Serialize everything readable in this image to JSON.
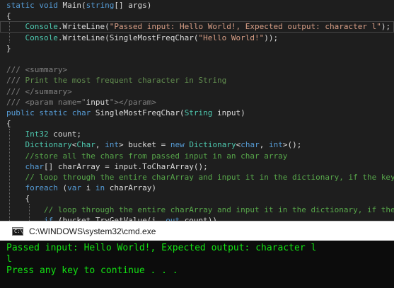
{
  "code_lines": [
    [
      {
        "t": "static ",
        "c": "t-kw"
      },
      {
        "t": "void ",
        "c": "t-kw"
      },
      {
        "t": "Main(",
        "c": "t-pl"
      },
      {
        "t": "string",
        "c": "t-kw"
      },
      {
        "t": "[] args)",
        "c": "t-pl"
      }
    ],
    [
      {
        "t": "{",
        "c": "t-pl"
      }
    ],
    [
      {
        "t": "    ",
        "c": "t-pl"
      },
      {
        "t": "Console",
        "c": "t-ty"
      },
      {
        "t": ".WriteLine(",
        "c": "t-pl"
      },
      {
        "t": "\"Passed input: Hello World!, Expected output: character l\"",
        "c": "t-str"
      },
      {
        "t": ");",
        "c": "t-pl"
      }
    ],
    [
      {
        "t": "    ",
        "c": "t-pl"
      },
      {
        "t": "Console",
        "c": "t-ty"
      },
      {
        "t": ".WriteLine(SingleMostFreqChar(",
        "c": "t-pl"
      },
      {
        "t": "\"Hello World!\"",
        "c": "t-str"
      },
      {
        "t": "));",
        "c": "t-pl"
      }
    ],
    [
      {
        "t": "}",
        "c": "t-pl"
      }
    ],
    [],
    [
      {
        "t": "/// ",
        "c": "t-tag"
      },
      {
        "t": "<summary>",
        "c": "t-tag"
      }
    ],
    [
      {
        "t": "/// ",
        "c": "t-tag"
      },
      {
        "t": "Print the most frequent character in String",
        "c": "t-dc"
      }
    ],
    [
      {
        "t": "/// ",
        "c": "t-tag"
      },
      {
        "t": "</summary>",
        "c": "t-tag"
      }
    ],
    [
      {
        "t": "/// ",
        "c": "t-tag"
      },
      {
        "t": "<param ",
        "c": "t-tag"
      },
      {
        "t": "name",
        "c": "t-tag"
      },
      {
        "t": "=\"",
        "c": "t-tag"
      },
      {
        "t": "input",
        "c": "t-pl"
      },
      {
        "t": "\">",
        "c": "t-tag"
      },
      {
        "t": "</param>",
        "c": "t-tag"
      }
    ],
    [
      {
        "t": "public ",
        "c": "t-kw"
      },
      {
        "t": "static ",
        "c": "t-kw"
      },
      {
        "t": "char ",
        "c": "t-kw"
      },
      {
        "t": "SingleMostFreqChar(",
        "c": "t-pl"
      },
      {
        "t": "String ",
        "c": "t-ty"
      },
      {
        "t": "input)",
        "c": "t-pl"
      }
    ],
    [
      {
        "t": "{",
        "c": "t-pl"
      }
    ],
    [
      {
        "t": "    ",
        "c": "t-pl"
      },
      {
        "t": "Int32 ",
        "c": "t-ty"
      },
      {
        "t": "count;",
        "c": "t-pl"
      }
    ],
    [
      {
        "t": "    ",
        "c": "t-pl"
      },
      {
        "t": "Dictionary",
        "c": "t-ty"
      },
      {
        "t": "<",
        "c": "t-pl"
      },
      {
        "t": "Char",
        "c": "t-ty"
      },
      {
        "t": ", ",
        "c": "t-pl"
      },
      {
        "t": "int",
        "c": "t-kw"
      },
      {
        "t": "> bucket = ",
        "c": "t-pl"
      },
      {
        "t": "new ",
        "c": "t-kw"
      },
      {
        "t": "Dictionary",
        "c": "t-ty"
      },
      {
        "t": "<",
        "c": "t-pl"
      },
      {
        "t": "char",
        "c": "t-kw"
      },
      {
        "t": ", ",
        "c": "t-pl"
      },
      {
        "t": "int",
        "c": "t-kw"
      },
      {
        "t": ">();",
        "c": "t-pl"
      }
    ],
    [
      {
        "t": "    ",
        "c": "t-pl"
      },
      {
        "t": "//store all the chars from passed input in an char array",
        "c": "t-cm"
      }
    ],
    [
      {
        "t": "    ",
        "c": "t-pl"
      },
      {
        "t": "char",
        "c": "t-kw"
      },
      {
        "t": "[] charArray = input.ToCharArray();",
        "c": "t-pl"
      }
    ],
    [
      {
        "t": "    ",
        "c": "t-pl"
      },
      {
        "t": "// loop through the entire charArray and input it in the dictionary, if the key al",
        "c": "t-cm"
      }
    ],
    [
      {
        "t": "    ",
        "c": "t-pl"
      },
      {
        "t": "foreach ",
        "c": "t-kw"
      },
      {
        "t": "(",
        "c": "t-pl"
      },
      {
        "t": "var ",
        "c": "t-kw"
      },
      {
        "t": "i ",
        "c": "t-pl"
      },
      {
        "t": "in ",
        "c": "t-kw"
      },
      {
        "t": "charArray)",
        "c": "t-pl"
      }
    ],
    [
      {
        "t": "    {",
        "c": "t-pl"
      }
    ],
    [
      {
        "t": "        ",
        "c": "t-pl"
      },
      {
        "t": "// loop through the entire charArray and input it in the dictionary, if the ke",
        "c": "t-cm"
      }
    ],
    [
      {
        "t": "        ",
        "c": "t-pl"
      },
      {
        "t": "if ",
        "c": "t-kw"
      },
      {
        "t": "(bucket.TryGetValue(i, ",
        "c": "t-pl"
      },
      {
        "t": "out ",
        "c": "t-kw"
      },
      {
        "t": "count))",
        "c": "t-pl"
      }
    ]
  ],
  "console": {
    "title": "C:\\WINDOWS\\system32\\cmd.exe",
    "icon_text": "C:\\",
    "lines": [
      "Passed input: Hello World!, Expected output: character l",
      "l",
      "Press any key to continue . . ."
    ]
  }
}
